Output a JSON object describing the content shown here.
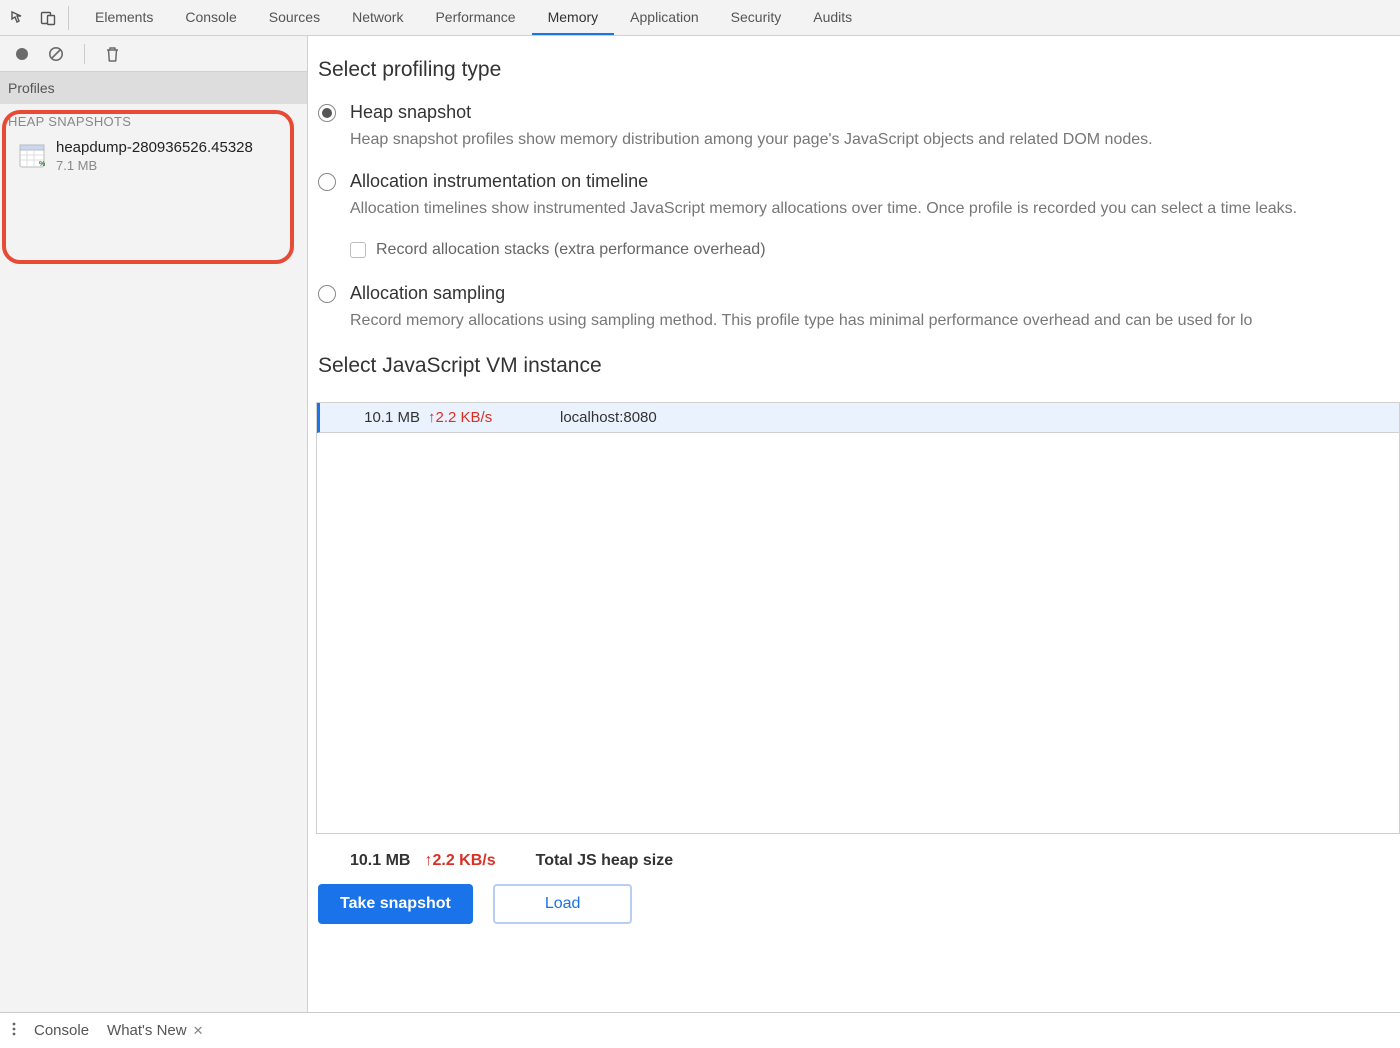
{
  "topbar": {
    "tabs": [
      "Elements",
      "Console",
      "Sources",
      "Network",
      "Performance",
      "Memory",
      "Application",
      "Security",
      "Audits"
    ],
    "active_tab": "Memory"
  },
  "sidebar": {
    "section_title": "Profiles",
    "group_title": "HEAP SNAPSHOTS",
    "snapshot": {
      "name": "heapdump-280936526.45328",
      "size": "7.1 MB"
    }
  },
  "content": {
    "profiling_title": "Select profiling type",
    "options": [
      {
        "label": "Heap snapshot",
        "desc": "Heap snapshot profiles show memory distribution among your page's JavaScript objects and related DOM nodes.",
        "checked": true
      },
      {
        "label": "Allocation instrumentation on timeline",
        "desc": "Allocation timelines show instrumented JavaScript memory allocations over time. Once profile is recorded you can select a time leaks.",
        "checked": false,
        "checkbox_label": "Record allocation stacks (extra performance overhead)"
      },
      {
        "label": "Allocation sampling",
        "desc": "Record memory allocations using sampling method. This profile type has minimal performance overhead and can be used for lo",
        "checked": false
      }
    ],
    "vm_title": "Select JavaScript VM instance",
    "vm_row": {
      "size": "10.1 MB",
      "rate": "2.2 KB/s",
      "origin": "localhost:8080"
    },
    "footer": {
      "size": "10.1 MB",
      "rate": "2.2 KB/s",
      "label": "Total JS heap size"
    },
    "buttons": {
      "primary": "Take snapshot",
      "secondary": "Load"
    }
  },
  "drawer": {
    "tabs": [
      "Console",
      "What's New"
    ]
  }
}
